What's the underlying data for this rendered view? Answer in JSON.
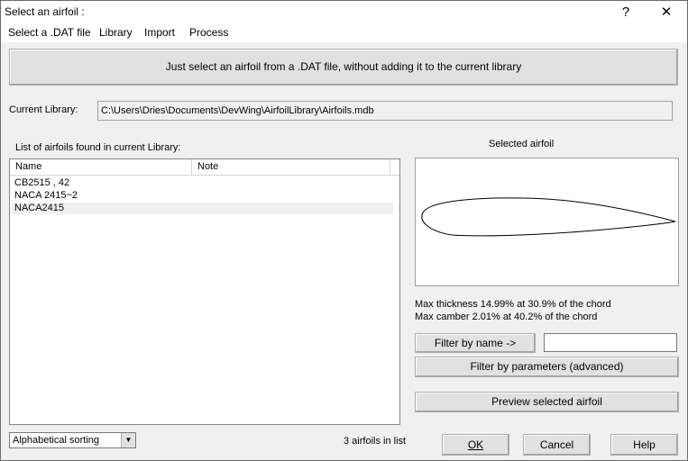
{
  "window": {
    "title": "Select an airfoil :",
    "help_glyph": "?",
    "close_glyph": "✕"
  },
  "menu": [
    {
      "label": "Select a .DAT file"
    },
    {
      "label": "Library"
    },
    {
      "label": "Import"
    },
    {
      "label": "Process"
    }
  ],
  "top_button": {
    "label": "Just select an airfoil from a .DAT file, without adding it to the current library"
  },
  "current_library": {
    "label": "Current Library:",
    "path": "C:\\Users\\Dries\\Documents\\DevWing\\AirfoilLibrary\\Airfoils.mdb"
  },
  "list": {
    "caption": "List of airfoils found in current Library:",
    "columns": [
      "Name",
      "Note"
    ],
    "rows": [
      {
        "name": "CB2515 ,  42",
        "note": ""
      },
      {
        "name": "NACA 2415~2",
        "note": ""
      },
      {
        "name": "NACA2415",
        "note": ""
      }
    ],
    "selected_index": 2,
    "count_text": "3 airfoils in list"
  },
  "sorting": {
    "selected": "Alphabetical sorting",
    "arrow_icon": "chevron-down-icon"
  },
  "selected_airfoil": {
    "caption": "Selected airfoil",
    "thickness_text": "Max thickness 14.99% at 30.9% of the chord",
    "camber_text": "Max camber  2.01% at 40.2% of the chord"
  },
  "filters": {
    "by_name_label": "Filter by name ->",
    "name_value": "",
    "by_params_label": "Filter by parameters (advanced)",
    "preview_label": "Preview selected airfoil"
  },
  "dialog_buttons": {
    "ok": "OK",
    "cancel": "Cancel",
    "help": "Help"
  }
}
